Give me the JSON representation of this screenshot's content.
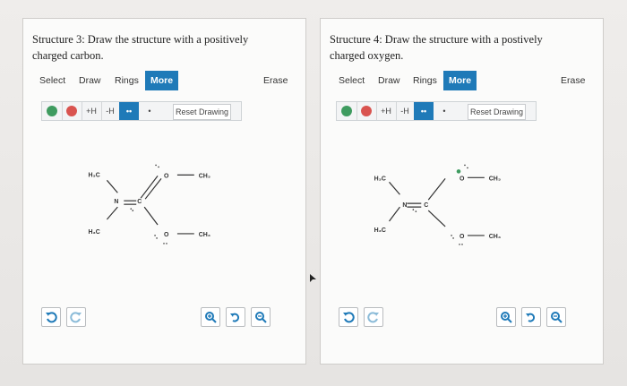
{
  "panels": [
    {
      "prompt": "Structure 3: Draw the structure with a positively charged carbon.",
      "tabs": [
        "Select",
        "Draw",
        "Rings",
        "More",
        "Erase"
      ],
      "active_tab": "More",
      "toolbar": {
        "add_h": "+H",
        "remove_h": "-H",
        "radical": "•",
        "lone_pair": "••",
        "reset_label": "Reset Drawing"
      },
      "molecule": {
        "h3c_top": "H₃C",
        "h3c_bottom": "H₃C",
        "n": "N",
        "c": "C",
        "o_top": "O",
        "o_bottom": "O",
        "ch3_top": "CH₃",
        "ch3_bottom": "CH₃"
      }
    },
    {
      "prompt": "Structure 4: Draw the structure with a postively charged oxygen.",
      "tabs": [
        "Select",
        "Draw",
        "Rings",
        "More",
        "Erase"
      ],
      "active_tab": "More",
      "toolbar": {
        "add_h": "+H",
        "remove_h": "-H",
        "radical": "•",
        "lone_pair": "••",
        "reset_label": "Reset Drawing"
      },
      "molecule": {
        "h3c_top": "H₃C",
        "h3c_bottom": "H₃C",
        "n": "N",
        "c": "C",
        "o_top": "O",
        "o_bottom": "O",
        "ch3_top": "CH₃",
        "ch3_bottom": "CH₃"
      }
    }
  ],
  "colors": {
    "accent": "#1f7ab8",
    "positive": "#3e9b5f",
    "negative": "#d9534f"
  },
  "icons": [
    "undo-icon",
    "redo-icon",
    "zoom-in-icon",
    "reset-zoom-icon",
    "zoom-out-icon"
  ]
}
